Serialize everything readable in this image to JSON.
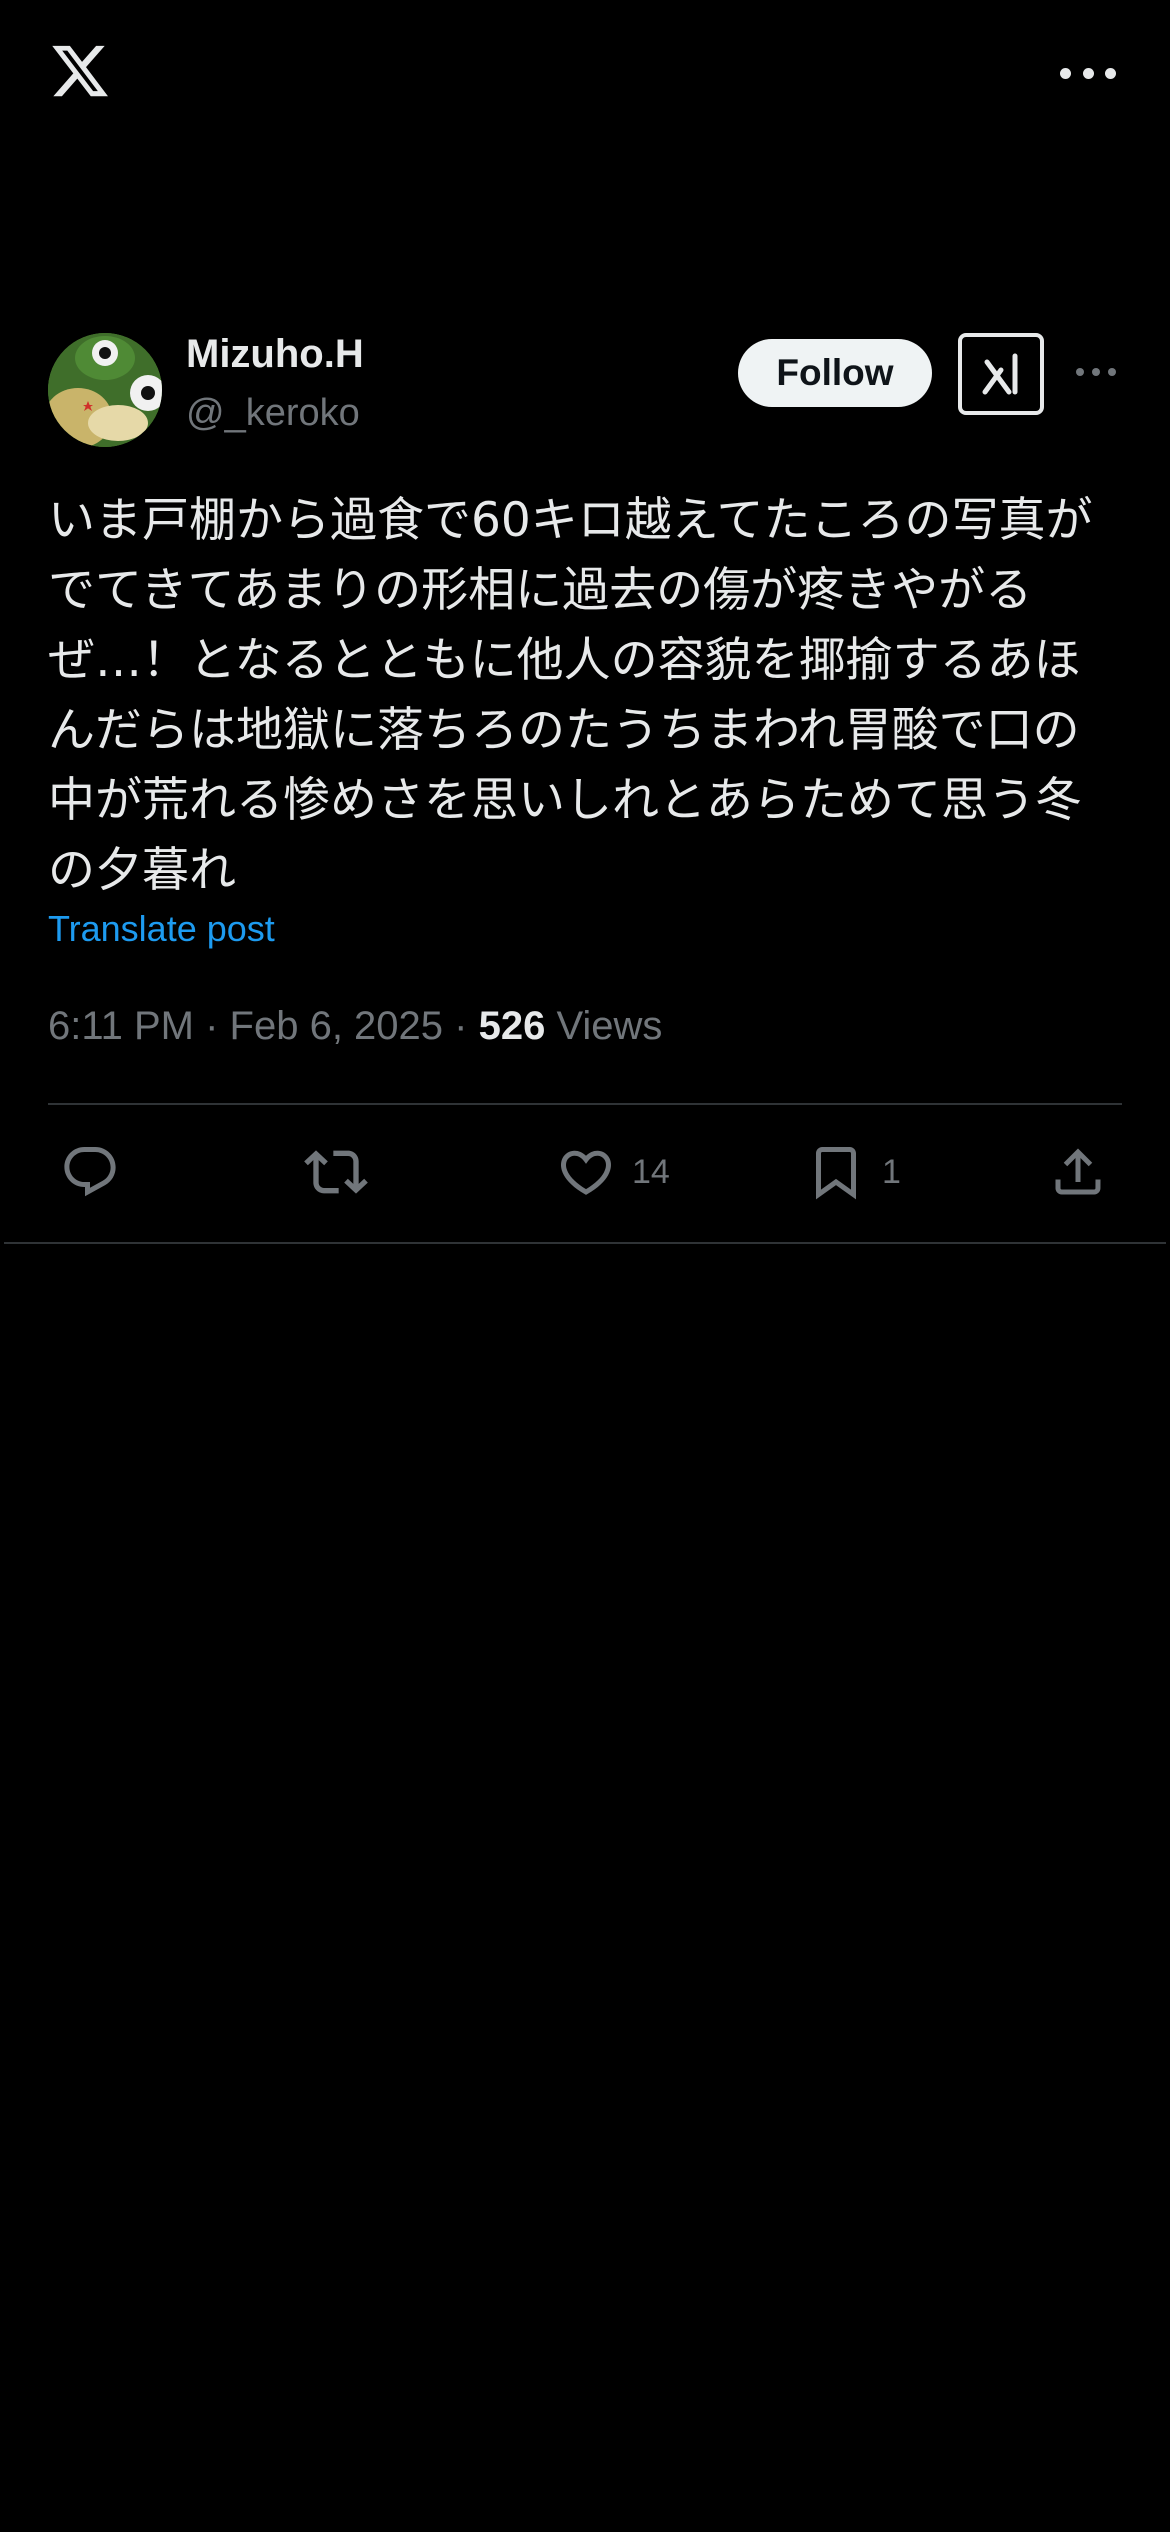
{
  "header": {
    "logo_icon": "x-logo-icon",
    "more_icon": "more-horizontal-icon"
  },
  "post": {
    "author_name": "Mizuho.H",
    "author_handle": "@_keroko",
    "follow_label": "Follow",
    "text": "いま戸棚から過食で60キロ越えてたころの写真が\nでてきてあまりの形相に過去の傷が疼きやがる\nぜ…！となるとともに他人の容貌を揶揄するあほ\nんだらは地獄に落ちろのたうちまわれ胃酸で口の\n中が荒れる惨めさを思いしれとあらためて思う冬\nの夕暮れ",
    "translate_label": "Translate post",
    "timestamp": "6:11 PM · Feb 6, 2025 · ",
    "views_count": "526",
    "views_label": " Views"
  },
  "actions": {
    "reply_icon": "reply-icon",
    "repost_icon": "repost-icon",
    "like_icon": "heart-icon",
    "like_count": "14",
    "bookmark_icon": "bookmark-icon",
    "bookmark_count": "1",
    "share_icon": "share-icon"
  },
  "colors": {
    "background": "#000000",
    "text": "#e7e9ea",
    "muted": "#71767b",
    "link": "#1d9bf0",
    "divider": "#2f3336"
  }
}
